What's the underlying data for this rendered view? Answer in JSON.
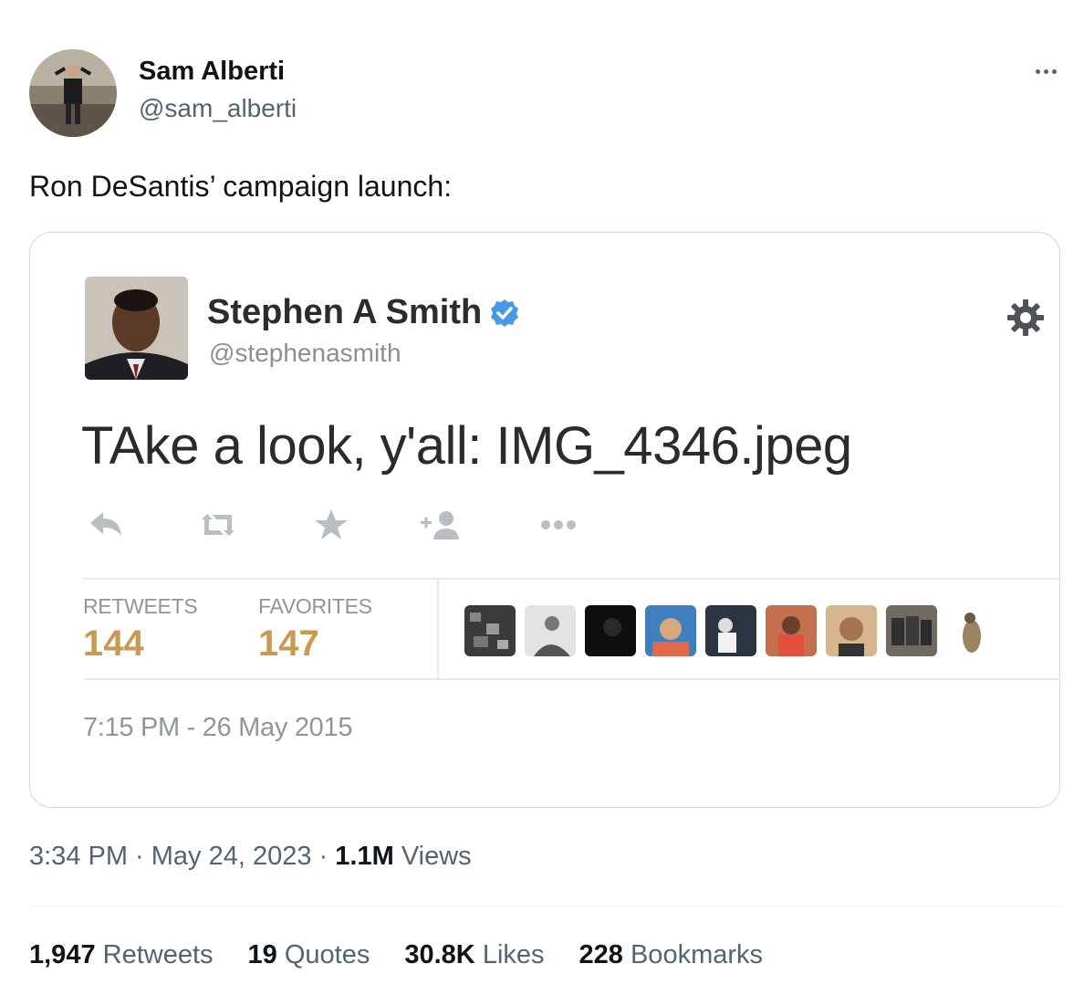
{
  "tweet": {
    "author": {
      "display_name": "Sam Alberti",
      "handle": "@sam_alberti"
    },
    "text": "Ron DeSantis’ campaign launch:",
    "timestamp": "3:34 PM · May 24, 2023 · ",
    "views_count": "1.1M",
    "views_label": " Views",
    "stats": {
      "retweets_count": "1,947",
      "retweets_label": "Retweets",
      "quotes_count": "19",
      "quotes_label": "Quotes",
      "likes_count": "30.8K",
      "likes_label": "Likes",
      "bookmarks_count": "228",
      "bookmarks_label": "Bookmarks"
    }
  },
  "embedded": {
    "display_name": "Stephen A Smith",
    "handle": "@stephenasmith",
    "text": "TAke a look, y'all: IMG_4346.jpeg",
    "retweets_label": "RETWEETS",
    "retweets_value": "144",
    "favorites_label": "FAVORITES",
    "favorites_value": "147",
    "timestamp": "7:15 PM - 26 May 2015",
    "icons": [
      "reply-icon",
      "retweet-icon",
      "favorite-icon",
      "follow-icon",
      "more-icon",
      "gear-icon",
      "verified-badge-icon"
    ]
  },
  "colors": {
    "text_primary": "#0f1419",
    "text_secondary": "#536471",
    "border": "#cfd9de",
    "verified": "#4a99e9",
    "stat_value": "#c89a52"
  }
}
